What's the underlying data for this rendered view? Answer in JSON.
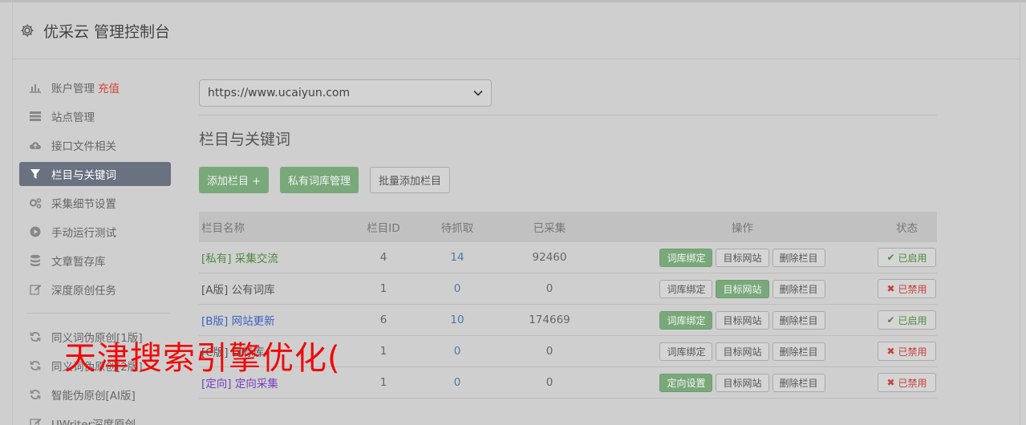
{
  "header": {
    "title": "优采云 管理控制台",
    "icon": "gear-icon"
  },
  "sidebar": {
    "items": [
      {
        "label": "账户管理",
        "extra": "充值",
        "icon": "bar-chart-icon"
      },
      {
        "label": "站点管理",
        "icon": "server-icon"
      },
      {
        "label": "接口文件相关",
        "icon": "cloud-upload-icon"
      },
      {
        "label": "栏目与关键词",
        "icon": "filter-icon",
        "active": true
      },
      {
        "label": "采集细节设置",
        "icon": "cogs-icon"
      },
      {
        "label": "手动运行测试",
        "icon": "play-circle-icon"
      },
      {
        "label": "文章暂存库",
        "icon": "database-icon"
      },
      {
        "label": "深度原创任务",
        "icon": "edit-icon"
      }
    ],
    "items2": [
      {
        "label": "同义词伪原创[1版]",
        "icon": "refresh-icon"
      },
      {
        "label": "同义词伪原创[2版]",
        "icon": "refresh-icon"
      },
      {
        "label": "智能伪原创[AI版]",
        "icon": "refresh-icon"
      },
      {
        "label": "UWriter深度原创",
        "icon": "edit-icon"
      }
    ]
  },
  "main": {
    "site_select": {
      "value": "https://www.ucaiyun.com",
      "icon": "chevron-down-icon"
    },
    "section_title": "栏目与关键词",
    "buttons": {
      "add": "添加栏目 +",
      "private_lib": "私有词库管理",
      "batch_add": "批量添加栏目"
    },
    "table": {
      "headers": [
        "栏目名称",
        "栏目ID",
        "待抓取",
        "已采集",
        "操作",
        "状态"
      ],
      "rows": [
        {
          "tag": "[私有]",
          "name": "采集交流",
          "id": "4",
          "pending": "14",
          "collected": "92460",
          "op1": "词库绑定",
          "op2": "目标网站",
          "op3": "删除栏目",
          "status": "已启用"
        },
        {
          "tag": "[A版]",
          "name": "公有词库",
          "id": "1",
          "pending": "0",
          "collected": "0",
          "op1": "词库绑定",
          "op2": "目标网站",
          "op3": "删除栏目",
          "status": "已禁用"
        },
        {
          "tag": "[B版]",
          "name": "网站更新",
          "id": "6",
          "pending": "10",
          "collected": "174669",
          "op1": "词库绑定",
          "op2": "目标网站",
          "op3": "删除栏目",
          "status": "已启用"
        },
        {
          "tag": "[C版]",
          "name": "目标库",
          "id": "1",
          "pending": "0",
          "collected": "0",
          "op1": "词库绑定",
          "op2": "目标网站",
          "op3": "删除栏目",
          "status": "已禁用"
        },
        {
          "tag": "[定向]",
          "name": "定向采集",
          "id": "1",
          "pending": "0",
          "collected": "0",
          "op1": "定向设置",
          "op2": "目标网站",
          "op3": "删除栏目",
          "status": "已禁用"
        }
      ]
    }
  },
  "watermark": "天津搜索引擎优化(",
  "colors": {
    "accent_green": "#79a97a",
    "active_nav": "#6a7180",
    "danger": "#c9403a"
  }
}
